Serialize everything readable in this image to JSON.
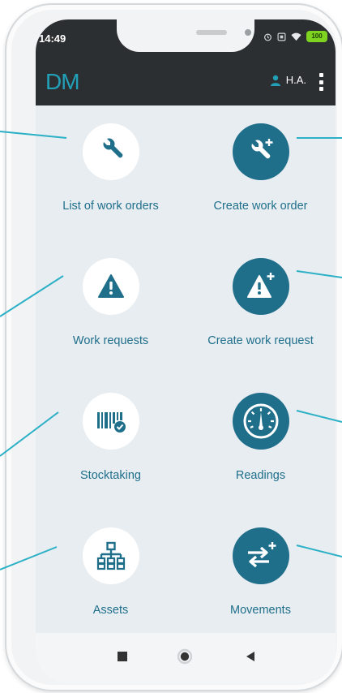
{
  "status_bar": {
    "time": "14:49",
    "battery": "100",
    "icons": [
      "alarm-icon",
      "nfc-icon",
      "wifi-icon",
      "battery-icon"
    ]
  },
  "app_bar": {
    "logo": "DM",
    "user_initials": "H.A.",
    "icons": [
      "user-icon",
      "more-vert-icon"
    ]
  },
  "tiles": [
    {
      "label": "List of work orders",
      "icon": "wrench-icon",
      "style": "white"
    },
    {
      "label": "Create work order",
      "icon": "wrench-plus-icon",
      "style": "teal"
    },
    {
      "label": "Work requests",
      "icon": "warning-icon",
      "style": "white"
    },
    {
      "label": "Create work request",
      "icon": "warning-plus-icon",
      "style": "teal"
    },
    {
      "label": "Stocktaking",
      "icon": "barcode-check-icon",
      "style": "white"
    },
    {
      "label": "Readings",
      "icon": "gauge-icon",
      "style": "teal"
    },
    {
      "label": "Assets",
      "icon": "hierarchy-icon",
      "style": "white"
    },
    {
      "label": "Movements",
      "icon": "transfer-plus-icon",
      "style": "teal"
    }
  ],
  "nav_bar": {
    "icons": [
      "recents-icon",
      "home-icon",
      "back-icon"
    ]
  },
  "colors": {
    "accent": "#1f6f8b",
    "logo": "#22a0b8",
    "background": "#e8edf1",
    "bar": "#2c2f31",
    "callout": "#2bb0c6"
  }
}
